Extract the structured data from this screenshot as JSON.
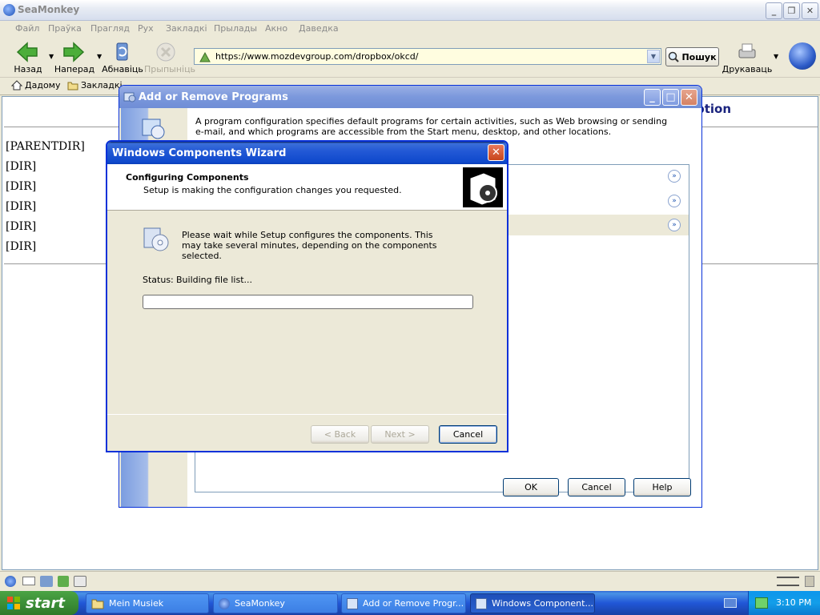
{
  "browser": {
    "title": "SeaMonkey",
    "menu": [
      "Файл",
      "Праўка",
      "Прагляд",
      "Рух",
      "Закладкі",
      "Прылады",
      "Акно",
      "Даведка"
    ],
    "nav": {
      "back": "Назад",
      "forward": "Наперад",
      "reload": "Абнавіць",
      "stop": "Прыпыніць",
      "print": "Друкаваць"
    },
    "url": "https://www.mozdevgroup.com/dropbox/okcd/",
    "search_label": "Пошук",
    "bookmarks": {
      "home": "Дадому",
      "bookmarks": "Закладкі"
    },
    "page_heading_fragment": "ption",
    "dir_entries": [
      "[PARENTDIR]",
      "[DIR]",
      "[DIR]",
      "[DIR]",
      "[DIR]",
      "[DIR]"
    ]
  },
  "arp": {
    "title": "Add or Remove Programs",
    "description": "A program configuration specifies default programs for certain activities, such as Web browsing or sending e-mail, and which programs are accessible from the Start menu, desktop, and other locations.",
    "buttons": {
      "ok": "OK",
      "cancel": "Cancel",
      "help": "Help"
    }
  },
  "wizard": {
    "title": "Windows Components Wizard",
    "header_title": "Configuring Components",
    "header_subtitle": "Setup is making the configuration changes you requested.",
    "message": "Please wait while Setup configures the components. This may take several minutes, depending on the components selected.",
    "status_label": "Status:",
    "status_value": "Building file list...",
    "progress": 0,
    "buttons": {
      "back": "< Back",
      "next": "Next >",
      "cancel": "Cancel"
    }
  },
  "taskbar": {
    "start": "start",
    "tasks": [
      "Mein Musiek",
      "SeaMonkey",
      "Add or Remove Progr...",
      "Windows Component..."
    ],
    "clock": "3:10 PM"
  },
  "colors": {
    "xp_blue": "#0a3fb8",
    "start_green": "#3c8f37",
    "url_bg": "#fffde0"
  }
}
